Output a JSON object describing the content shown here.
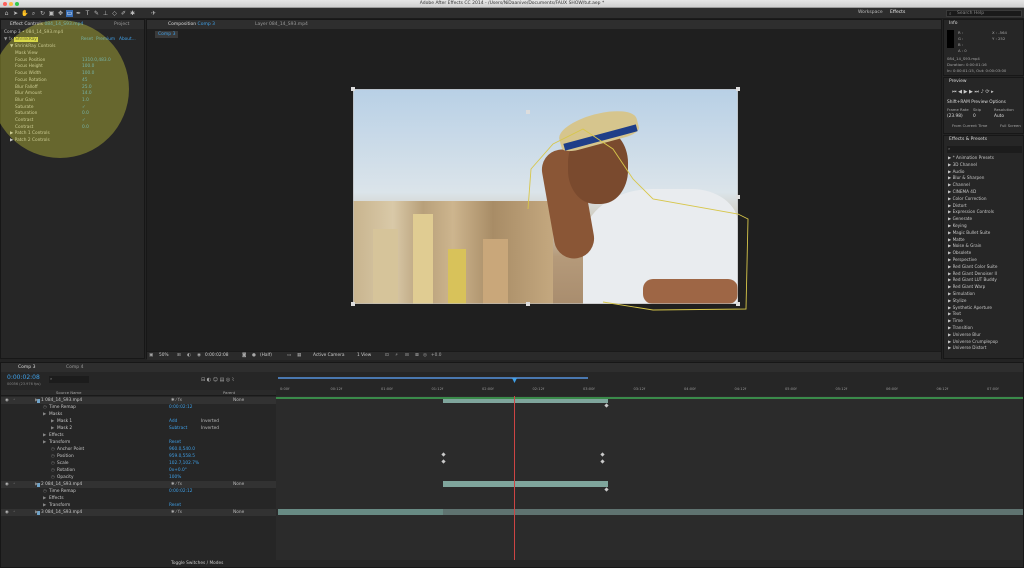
{
  "window": {
    "title": "Adobe After Effects CC 2014 - /Users/NiDaanive/Documents/FAUX SHOW/tut.aep *"
  },
  "toolbar": {
    "workspace_label": "Workspace",
    "workspace_value": "Effects",
    "search_placeholder": "Search Help"
  },
  "effect_controls": {
    "tab_label": "Effect Controls",
    "tab_file": "084_14_S93.mp4",
    "project_tab": "Project",
    "breadcrumb": "Comp 3 • 084_14_S93.mp4",
    "effect_name": "ShrinkRay",
    "reset": "Reset",
    "premium": "Premium",
    "about": "About...",
    "section": "ShrinkRay Controls",
    "params": [
      {
        "label": "Mask View",
        "value": ""
      },
      {
        "label": "Focus Position",
        "value": "1310.0,483.0"
      },
      {
        "label": "Focus Height",
        "value": "100.0"
      },
      {
        "label": "Focus Width",
        "value": "100.0"
      },
      {
        "label": "Focus Rotation",
        "value": "45"
      },
      {
        "label": "Blur Falloff",
        "value": "25.0"
      },
      {
        "label": "Blur Amount",
        "value": "14.0"
      },
      {
        "label": "Blur Gain",
        "value": "1.0"
      },
      {
        "label": "Saturate",
        "value": "✓"
      },
      {
        "label": "Saturation",
        "value": "0.0"
      },
      {
        "label": "Contrast",
        "value": "✓"
      },
      {
        "label": "Contrast",
        "value": "0.0"
      }
    ],
    "patches": [
      "Patch 1 Controls",
      "Patch 2 Controls"
    ]
  },
  "composition": {
    "tab_label": "Composition",
    "tab_comp": "Comp 3",
    "layer_tab": "Layer 084_14_S93.mp4",
    "subtab": "Comp 3",
    "zoom": "50%",
    "timecode": "0:00:02:08",
    "quality": "(Half)",
    "camera": "Active Camera",
    "view": "1 View",
    "exposure": "+0.0"
  },
  "info": {
    "tab": "Info",
    "r": "R :",
    "g": "G :",
    "b": "B :",
    "a": "A : 0",
    "x": "X : -564",
    "y": "Y : 252",
    "file": "084_14_S93.mp4",
    "duration": "Duration: 0:00:01:16",
    "inout": "In: 0:00:01:15, Out: 0:00:03:00"
  },
  "preview": {
    "tab": "Preview",
    "options": "Shift+RAM Preview Options",
    "frame_rate_label": "Frame Rate",
    "skip_label": "Skip",
    "resolution_label": "Resolution",
    "frame_rate": "(23.98)",
    "skip": "0",
    "resolution": "Auto",
    "from_current": "From Current Time",
    "full_screen": "Full Screen"
  },
  "effects_presets": {
    "tab": "Effects & Presets",
    "search_placeholder": "",
    "items": [
      "* Animation Presets",
      "3D Channel",
      "Audio",
      "Blur & Sharpen",
      "Channel",
      "CINEMA 4D",
      "Color Correction",
      "Distort",
      "Expression Controls",
      "Generate",
      "Keying",
      "Magic Bullet Suite",
      "Matte",
      "Noise & Grain",
      "Obsolete",
      "Perspective",
      "Red Giant Color Suite",
      "Red Giant Denoiser II",
      "Red Giant LUT Buddy",
      "Red Giant Warp",
      "Simulation",
      "Stylize",
      "Synthetic Aperture",
      "Text",
      "Time",
      "Transition",
      "Universe Blur",
      "Universe Crumplepop",
      "Universe Distort"
    ]
  },
  "timeline": {
    "tab": "Comp 3",
    "tab2": "Comp 4",
    "timecode": "0:00:02:08",
    "frames": "00056 (23.976 fps)",
    "col_source": "Source Name",
    "col_parent": "Parent",
    "ruler": [
      "0:00f",
      "00:12f",
      "01:00f",
      "01:12f",
      "02:00f",
      "02:12f",
      "03:00f",
      "03:12f",
      "04:00f",
      "04:12f",
      "05:00f",
      "05:12f",
      "06:00f",
      "06:12f",
      "07:00f"
    ],
    "rows": [
      {
        "indent": 0,
        "text": "1   084_14_S93.mp4",
        "val": "",
        "parent": "None",
        "kind": "layer"
      },
      {
        "indent": 1,
        "text": "Time Remap",
        "val": "0:00:02:12",
        "parent": "",
        "kind": "prop"
      },
      {
        "indent": 1,
        "text": "Masks",
        "val": "",
        "parent": "",
        "kind": "group"
      },
      {
        "indent": 2,
        "text": "Mask 1",
        "val": "Add",
        "parent": "Inverted",
        "kind": "mask"
      },
      {
        "indent": 2,
        "text": "Mask 2",
        "val": "Subtract",
        "parent": "Inverted",
        "kind": "mask"
      },
      {
        "indent": 1,
        "text": "Effects",
        "val": "",
        "parent": "",
        "kind": "group"
      },
      {
        "indent": 1,
        "text": "Transform",
        "val": "Reset",
        "parent": "",
        "kind": "group"
      },
      {
        "indent": 2,
        "text": "Anchor Point",
        "val": "960.0,540.0",
        "parent": "",
        "kind": "prop"
      },
      {
        "indent": 2,
        "text": "Position",
        "val": "959.0,558.5",
        "parent": "",
        "kind": "prop"
      },
      {
        "indent": 2,
        "text": "Scale",
        "val": "102.7,102.7%",
        "parent": "",
        "kind": "prop"
      },
      {
        "indent": 2,
        "text": "Rotation",
        "val": "0x+0.0°",
        "parent": "",
        "kind": "prop"
      },
      {
        "indent": 2,
        "text": "Opacity",
        "val": "100%",
        "parent": "",
        "kind": "prop"
      },
      {
        "indent": 0,
        "text": "2   084_14_S93.mp4",
        "val": "",
        "parent": "None",
        "kind": "layer"
      },
      {
        "indent": 1,
        "text": "Time Remap",
        "val": "0:00:02:12",
        "parent": "",
        "kind": "prop"
      },
      {
        "indent": 1,
        "text": "Effects",
        "val": "",
        "parent": "",
        "kind": "group"
      },
      {
        "indent": 1,
        "text": "Transform",
        "val": "Reset",
        "parent": "",
        "kind": "group"
      },
      {
        "indent": 0,
        "text": "3   084_14_S93.mp4",
        "val": "",
        "parent": "None",
        "kind": "layer"
      }
    ],
    "toggle": "Toggle Switches / Modes"
  }
}
